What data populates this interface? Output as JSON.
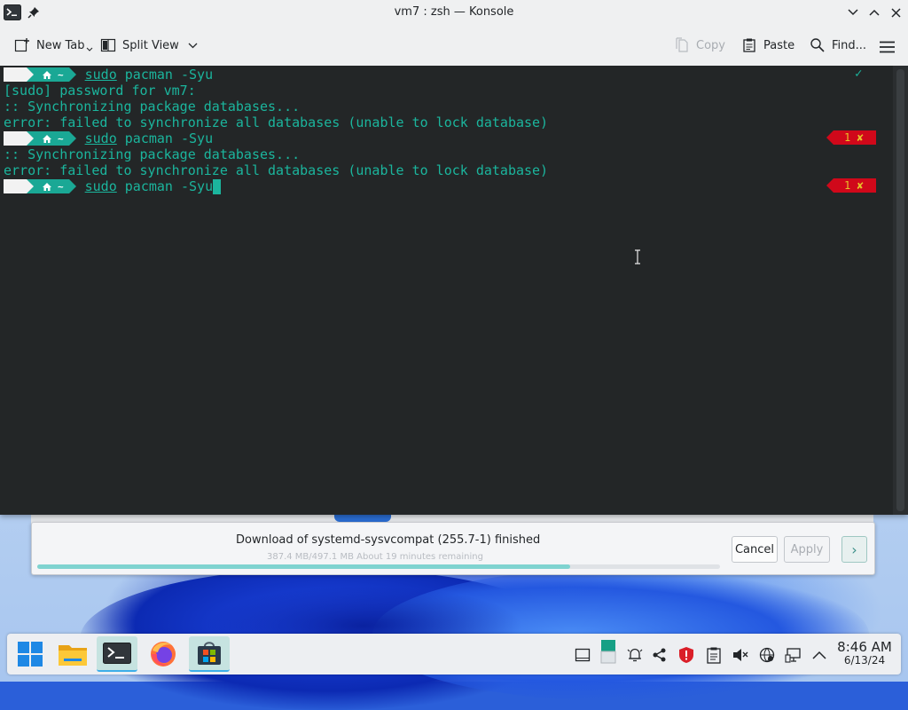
{
  "window": {
    "title": "vm7 : zsh — Konsole"
  },
  "toolbar": {
    "new_tab": "New Tab",
    "split_view": "Split View",
    "copy": "Copy",
    "paste": "Paste",
    "find": "Find..."
  },
  "terminal": {
    "prompt_dir": "~",
    "prompt_os_glyph": "",
    "lines": [
      {
        "type": "prompt",
        "sudo": "sudo",
        "rest": " pacman -Syu",
        "status": "✓"
      },
      {
        "type": "output",
        "text": "[sudo] password for vm7:"
      },
      {
        "type": "output",
        "text": ":: Synchronizing package databases..."
      },
      {
        "type": "output",
        "text": "error: failed to synchronize all databases (unable to lock database)"
      },
      {
        "type": "prompt",
        "sudo": "sudo",
        "rest": " pacman -Syu",
        "status": "1 ✘"
      },
      {
        "type": "output",
        "text": ":: Synchronizing package databases..."
      },
      {
        "type": "output",
        "text": "error: failed to synchronize all databases (unable to lock database)"
      },
      {
        "type": "prompt",
        "sudo": "sudo",
        "rest": " pacman -Syu",
        "status": "1 ✘"
      }
    ]
  },
  "download": {
    "title": "Download of systemd-sysvcompat (255.7-1) finished",
    "subtitle": "387.4 MB/497.1 MB About 19 minutes remaining",
    "progress_percent": 78,
    "cancel": "Cancel",
    "apply": "Apply",
    "next": "›"
  },
  "taskbar": {
    "apps": [
      "start-menu",
      "file-manager",
      "konsole",
      "firefox",
      "microsoft-store"
    ]
  },
  "clock": {
    "time": "8:46 AM",
    "date": "6/13/24"
  },
  "colors": {
    "terminal_bg": "#232627",
    "terminal_fg": "#1bb59d",
    "error_badge": "#d0081a",
    "accent": "#3daee9"
  }
}
